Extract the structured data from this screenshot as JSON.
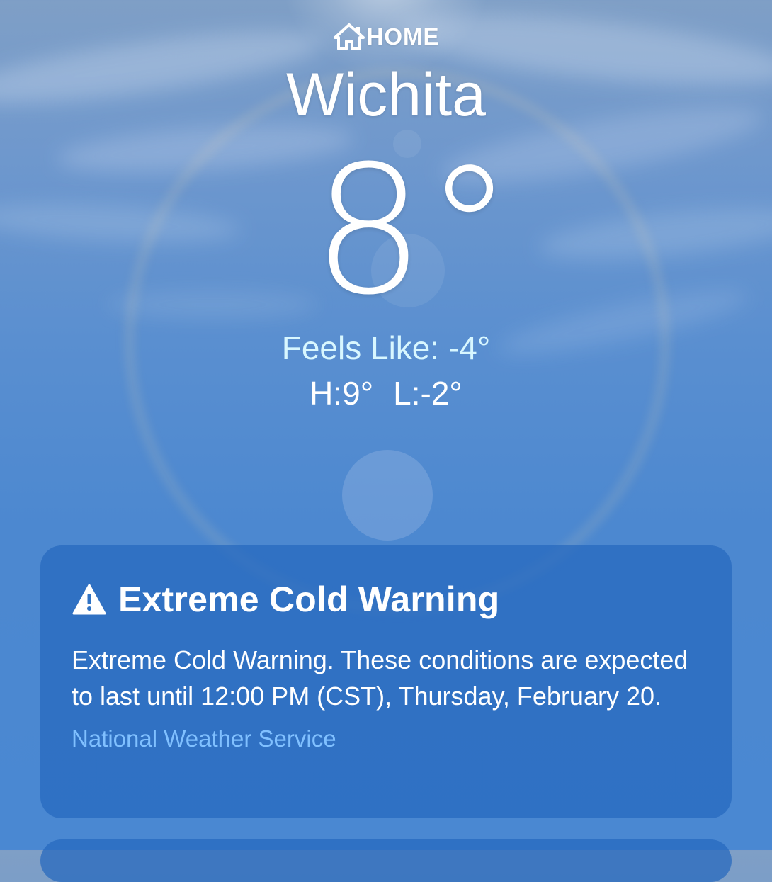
{
  "location": {
    "home_label": "HOME",
    "home_icon": "house-icon",
    "city": "Wichita"
  },
  "current": {
    "temperature": "8°",
    "feels_like": "Feels Like: -4°",
    "high": "H:9°",
    "low": "L:-2°"
  },
  "alert": {
    "icon": "warning-triangle-icon",
    "title": "Extreme Cold Warning",
    "body": "Extreme Cold Warning. These conditions are expected to last until 12:00 PM (CST), Thursday, February 20.",
    "source": "National Weather Service"
  },
  "colors": {
    "feels_like": "#d8f7ff",
    "source_link": "#80c0ff",
    "card_background": "#2668be"
  }
}
